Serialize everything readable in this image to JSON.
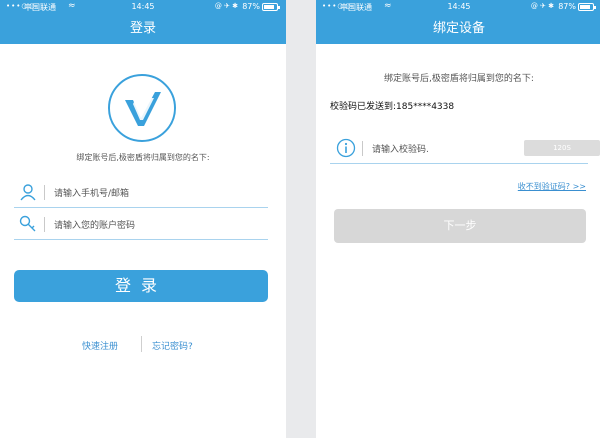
{
  "status_bar": {
    "signal": "•••○○",
    "carrier": "中国联通",
    "wifi": "≈",
    "time": "14:45",
    "icons": "@ ✈ ✱",
    "battery": "87%"
  },
  "login_screen": {
    "title": "登录",
    "slogan": "绑定账号后,极密盾将归属到您的名下:",
    "phone_placeholder": "请输入手机号/邮箱",
    "password_placeholder": "请输入您的账户密码",
    "login_button": "登录",
    "register_link": "快速注册",
    "forgot_link": "忘记密码?"
  },
  "bind_screen": {
    "title": "绑定设备",
    "slogan": "绑定账号后,极密盾将归属到您的名下:",
    "sent_text": "校验码已发送到:185****4338",
    "code_placeholder": "请输入校验码.",
    "resend_button": "120S",
    "no_code_link": "收不到验证码? >>",
    "next_button": "下一步"
  },
  "colors": {
    "primary": "#3aa1dc",
    "link": "#3a8fd0",
    "disabled": "#d7d7d7"
  }
}
